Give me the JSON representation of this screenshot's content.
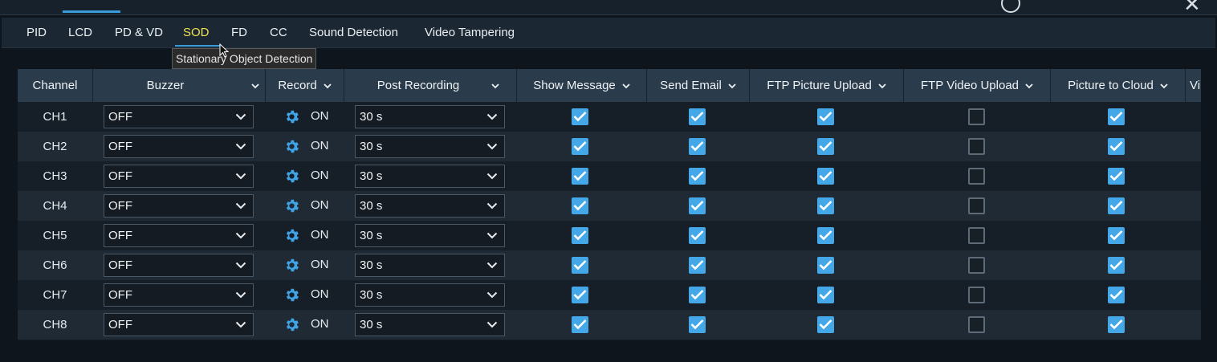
{
  "tabs": [
    "PID",
    "LCD",
    "PD & VD",
    "SOD",
    "FD",
    "CC",
    "Sound Detection",
    "Video Tampering"
  ],
  "active_tab": "SOD",
  "tooltip": "Stationary Object Detection",
  "columns": {
    "channel": "Channel",
    "buzzer": "Buzzer",
    "record": "Record",
    "post_recording": "Post Recording",
    "show_message": "Show Message",
    "send_email": "Send Email",
    "ftp_picture": "FTP Picture Upload",
    "ftp_video": "FTP Video Upload",
    "picture_cloud": "Picture to Cloud",
    "overflow": "Vi"
  },
  "rows": [
    {
      "channel": "CH1",
      "buzzer": "OFF",
      "record": "ON",
      "post": "30 s",
      "show_message": true,
      "send_email": true,
      "ftp_picture": true,
      "ftp_video": false,
      "picture_cloud": true
    },
    {
      "channel": "CH2",
      "buzzer": "OFF",
      "record": "ON",
      "post": "30 s",
      "show_message": true,
      "send_email": true,
      "ftp_picture": true,
      "ftp_video": false,
      "picture_cloud": true
    },
    {
      "channel": "CH3",
      "buzzer": "OFF",
      "record": "ON",
      "post": "30 s",
      "show_message": true,
      "send_email": true,
      "ftp_picture": true,
      "ftp_video": false,
      "picture_cloud": true
    },
    {
      "channel": "CH4",
      "buzzer": "OFF",
      "record": "ON",
      "post": "30 s",
      "show_message": true,
      "send_email": true,
      "ftp_picture": true,
      "ftp_video": false,
      "picture_cloud": true
    },
    {
      "channel": "CH5",
      "buzzer": "OFF",
      "record": "ON",
      "post": "30 s",
      "show_message": true,
      "send_email": true,
      "ftp_picture": true,
      "ftp_video": false,
      "picture_cloud": true
    },
    {
      "channel": "CH6",
      "buzzer": "OFF",
      "record": "ON",
      "post": "30 s",
      "show_message": true,
      "send_email": true,
      "ftp_picture": true,
      "ftp_video": false,
      "picture_cloud": true
    },
    {
      "channel": "CH7",
      "buzzer": "OFF",
      "record": "ON",
      "post": "30 s",
      "show_message": true,
      "send_email": true,
      "ftp_picture": true,
      "ftp_video": false,
      "picture_cloud": true
    },
    {
      "channel": "CH8",
      "buzzer": "OFF",
      "record": "ON",
      "post": "30 s",
      "show_message": true,
      "send_email": true,
      "ftp_picture": true,
      "ftp_video": false,
      "picture_cloud": true
    }
  ],
  "colors": {
    "accent": "#3a9bd9",
    "active_tab": "#f0e04e",
    "checkbox": "#43a7e8",
    "header_bg": "#2a3b4b"
  },
  "icons": {
    "record_settings": "gear-icon",
    "dropdown": "chevron-down-icon",
    "window_close": "close-icon"
  }
}
